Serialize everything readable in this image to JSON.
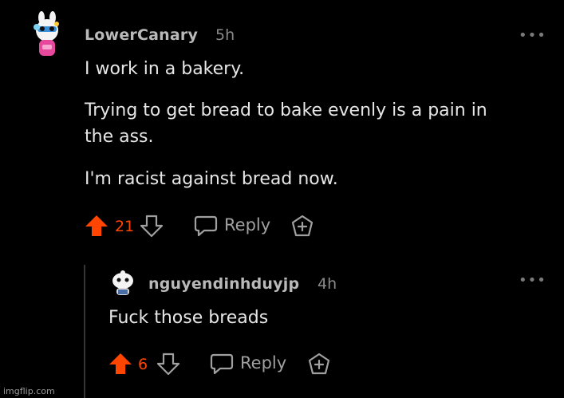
{
  "comment": {
    "username": "LowerCanary",
    "time": "5h",
    "paragraphs": [
      "I work in a bakery.",
      "Trying to get bread to bake evenly is a pain in",
      "the ass.",
      "I'm racist against bread now."
    ],
    "votes": "21",
    "reply_label": "Reply"
  },
  "reply": {
    "username": "nguyendinhduyjp",
    "time": "4h",
    "text": "Fuck those breads",
    "votes": "6",
    "reply_label": "Reply"
  },
  "more_icon": "•••",
  "watermark": "imgflip.com",
  "colors": {
    "accent": "#ff4500",
    "background": "#000000",
    "thread_line": "#343536"
  }
}
